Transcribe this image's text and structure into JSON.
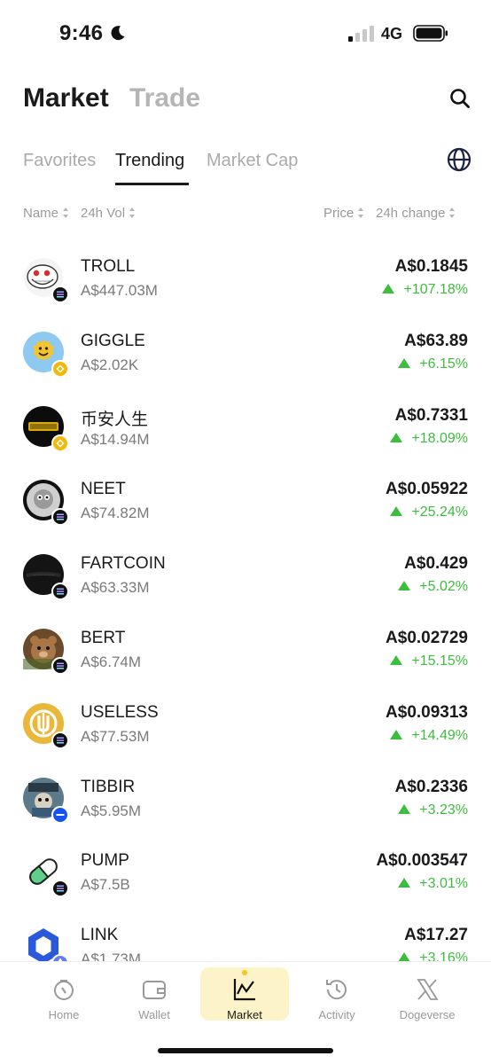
{
  "status_bar": {
    "time": "9:46",
    "network": "4G"
  },
  "header": {
    "market_tab": "Market",
    "trade_tab": "Trade"
  },
  "subtabs": {
    "favorites": "Favorites",
    "trending": "Trending",
    "market_cap": "Market Cap"
  },
  "columns": {
    "name": "Name",
    "volume": "24h Vol",
    "price": "Price",
    "change": "24h change"
  },
  "colors": {
    "positive": "#3dbd3d",
    "accent": "#fdf3c8"
  },
  "tokens": [
    {
      "symbol": "TROLL",
      "volume": "A$447.03M",
      "price": "A$0.1845",
      "change": "+107.18%",
      "logo": "troll-face-icon",
      "chain": "solana-chain-icon"
    },
    {
      "symbol": "GIGGLE",
      "volume": "A$2.02K",
      "price": "A$63.89",
      "change": "+6.15%",
      "logo": "giggle-logo-icon",
      "chain": "bnb-chain-icon"
    },
    {
      "symbol": "币安人生",
      "volume": "A$14.94M",
      "price": "A$0.7331",
      "change": "+18.09%",
      "logo": "binance-life-logo-icon",
      "chain": "bnb-chain-icon"
    },
    {
      "symbol": "NEET",
      "volume": "A$74.82M",
      "price": "A$0.05922",
      "change": "+25.24%",
      "logo": "neet-logo-icon",
      "chain": "solana-chain-icon"
    },
    {
      "symbol": "FARTCOIN",
      "volume": "A$63.33M",
      "price": "A$0.429",
      "change": "+5.02%",
      "logo": "fartcoin-logo-icon",
      "chain": "solana-chain-icon"
    },
    {
      "symbol": "BERT",
      "volume": "A$6.74M",
      "price": "A$0.02729",
      "change": "+15.15%",
      "logo": "bert-logo-icon",
      "chain": "solana-chain-icon"
    },
    {
      "symbol": "USELESS",
      "volume": "A$77.53M",
      "price": "A$0.09313",
      "change": "+14.49%",
      "logo": "useless-logo-icon",
      "chain": "solana-chain-icon"
    },
    {
      "symbol": "TIBBIR",
      "volume": "A$5.95M",
      "price": "A$0.2336",
      "change": "+3.23%",
      "logo": "tibbir-logo-icon",
      "chain": "base-chain-icon"
    },
    {
      "symbol": "PUMP",
      "volume": "A$7.5B",
      "price": "A$0.003547",
      "change": "+3.01%",
      "logo": "pump-pill-icon",
      "chain": "solana-chain-icon"
    },
    {
      "symbol": "LINK",
      "volume": "A$1.73M",
      "price": "A$17.27",
      "change": "+3.16%",
      "logo": "chainlink-logo-icon",
      "chain": "ethereum-chain-icon"
    }
  ],
  "bottom_nav": [
    {
      "label": "Home",
      "icon": "home-icon"
    },
    {
      "label": "Wallet",
      "icon": "wallet-icon"
    },
    {
      "label": "Market",
      "icon": "chart-icon",
      "active": true
    },
    {
      "label": "Activity",
      "icon": "history-icon"
    },
    {
      "label": "Dogeverse",
      "icon": "x-icon"
    }
  ]
}
